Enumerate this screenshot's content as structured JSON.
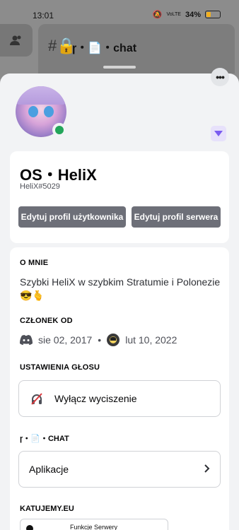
{
  "status_bar": {
    "time": "13:01",
    "network": "VoLTE",
    "battery": "34%",
    "battery_color": "#f2b01e"
  },
  "background": {
    "channel_name": "ɼ・📄・chat"
  },
  "profile": {
    "display_name": "OS・HeliX",
    "username": "HeliX#5029",
    "status_color": "#23a55a",
    "buttons": {
      "edit_user": "Edytuj profil użytkownika",
      "edit_server": "Edytuj profil serwera"
    }
  },
  "about": {
    "title": "O MNIE",
    "text": "Szybki HeliX w szybkim Stratumie i Polonezie",
    "emoji": "😎🫰"
  },
  "member_since": {
    "title": "CZŁONEK OD",
    "discord_date": "sie 02, 2017",
    "server_date": "lut 10, 2022"
  },
  "voice": {
    "title": "USTAWIENIA GŁOSU",
    "deafen_label": "Wyłącz wyciszenie"
  },
  "channel_section": {
    "title": "ɼ・📄・CHAT",
    "apps_label": "Aplikacje"
  },
  "server_section": {
    "title": "KATUJEMY.EU",
    "preview_label": "Funkcje Serwery"
  }
}
